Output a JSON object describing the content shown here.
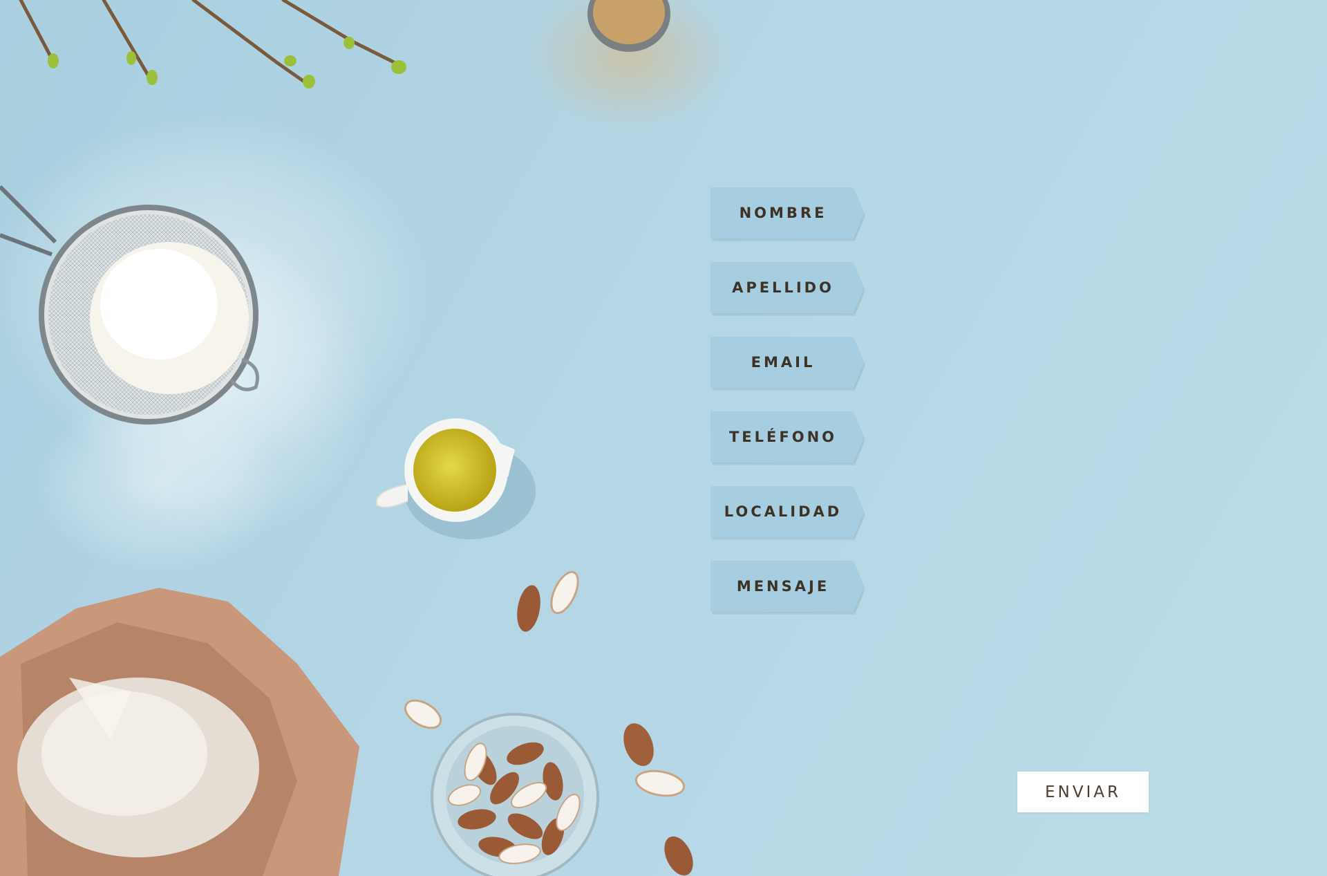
{
  "form": {
    "fields": [
      {
        "label": "NOMBRE"
      },
      {
        "label": "APELLIDO"
      },
      {
        "label": "EMAIL"
      },
      {
        "label": "TELÉFONO"
      },
      {
        "label": "LOCALIDAD"
      },
      {
        "label": "MENSAJE"
      }
    ],
    "submit_label": "ENVIAR"
  },
  "colors": {
    "background": "#b4d6e5",
    "field_fill": "#a7cde0",
    "field_text": "#3c3326",
    "button_fill": "#ffffff",
    "button_text": "#4a3c30"
  },
  "decorations": [
    "flowering-branches",
    "sifter-with-flour",
    "spilled-flour",
    "oil-jug",
    "spoon-of-sugar",
    "paper-flour-bag",
    "almonds",
    "bowl-of-almonds"
  ]
}
